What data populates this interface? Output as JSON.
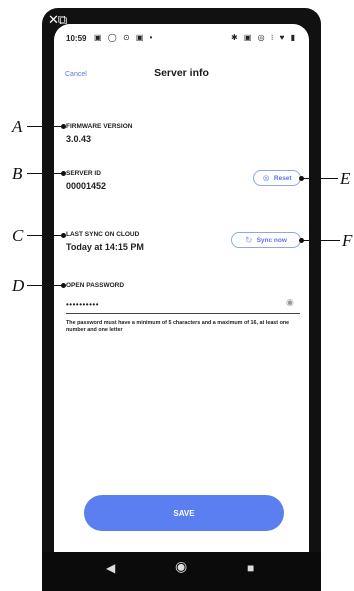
{
  "status_bar": {
    "time": "10:59",
    "left_icons": "▣ ◯ ⊙ ▣ •",
    "right_icons": "✱ ▣ ◎ ⁝ ♥ ▮"
  },
  "header": {
    "cancel": "Cancel",
    "title": "Server info"
  },
  "fields": {
    "firmware_label": "FIRMWARE VERSION",
    "firmware_value": "3.0.43",
    "server_id_label": "SERVER ID",
    "server_id_value": "00001452",
    "last_sync_label": "LAST SYNC ON CLOUD",
    "last_sync_value": "Today at 14:15 PM",
    "password_label": "OPEN PASSWORD",
    "password_value": "••••••••••",
    "password_hint": "The password must have a minimum of 5 characters and a maximum of 16, at least one number and one letter"
  },
  "buttons": {
    "reset": "Reset",
    "sync_now": "Sync now",
    "save": "SAVE"
  },
  "annotations": {
    "a": "A",
    "b": "B",
    "c": "C",
    "d": "D",
    "e": "E",
    "f": "F"
  },
  "icons": {
    "reset": "reset-x-icon",
    "sync": "refresh-icon",
    "eye": "eye-icon"
  },
  "colors": {
    "accent": "#5b74e8",
    "save_button": "#5b7ff0"
  }
}
